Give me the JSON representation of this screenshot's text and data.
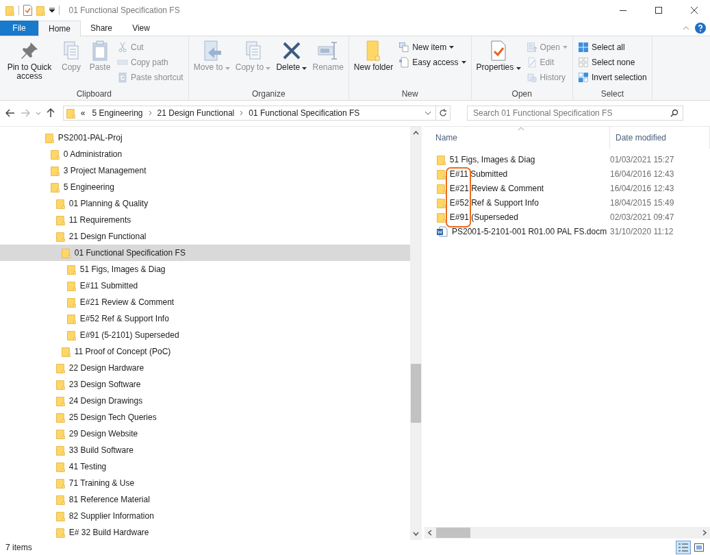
{
  "window": {
    "title": "01 Functional Specification FS"
  },
  "ribbon_tabs": [
    {
      "label": "File",
      "kind": "file",
      "selected": false
    },
    {
      "label": "Home",
      "kind": "tab",
      "selected": true
    },
    {
      "label": "Share",
      "kind": "tab",
      "selected": false
    },
    {
      "label": "View",
      "kind": "tab",
      "selected": false
    }
  ],
  "ribbon_groups": [
    {
      "label": "Clipboard",
      "large": [
        {
          "label": "Pin to Quick access",
          "disabled": false,
          "dropdown": false
        },
        {
          "label": "Copy",
          "disabled": true,
          "dropdown": false
        },
        {
          "label": "Paste",
          "disabled": true,
          "dropdown": false
        }
      ],
      "small": [
        {
          "label": "Cut",
          "disabled": true,
          "dropdown": false
        },
        {
          "label": "Copy path",
          "disabled": true,
          "dropdown": false
        },
        {
          "label": "Paste shortcut",
          "disabled": true,
          "dropdown": false
        }
      ]
    },
    {
      "label": "Organize",
      "large": [
        {
          "label": "Move to",
          "disabled": true,
          "dropdown": true
        },
        {
          "label": "Copy to",
          "disabled": true,
          "dropdown": true
        },
        {
          "label": "Delete",
          "disabled": false,
          "dropdown": true
        },
        {
          "label": "Rename",
          "disabled": true,
          "dropdown": false
        }
      ]
    },
    {
      "label": "New",
      "large": [
        {
          "label": "New folder",
          "disabled": false,
          "dropdown": false
        }
      ],
      "small": [
        {
          "label": "New item",
          "disabled": false,
          "dropdown": true
        },
        {
          "label": "Easy access",
          "disabled": false,
          "dropdown": true
        }
      ]
    },
    {
      "label": "Open",
      "large": [
        {
          "label": "Properties",
          "disabled": false,
          "dropdown": true
        }
      ],
      "small": [
        {
          "label": "Open",
          "disabled": true,
          "dropdown": true
        },
        {
          "label": "Edit",
          "disabled": true,
          "dropdown": false
        },
        {
          "label": "History",
          "disabled": true,
          "dropdown": false
        }
      ]
    },
    {
      "label": "Select",
      "small": [
        {
          "label": "Select all",
          "disabled": false,
          "dropdown": false
        },
        {
          "label": "Select none",
          "disabled": false,
          "dropdown": false
        },
        {
          "label": "Invert selection",
          "disabled": false,
          "dropdown": false
        }
      ]
    }
  ],
  "address": {
    "overflow": "«",
    "crumbs": [
      "5 Engineering",
      "21 Design Functional",
      "01 Functional Specification FS"
    ]
  },
  "search": {
    "placeholder": "Search 01 Functional Specification FS"
  },
  "tree": [
    {
      "label": "PS2001-PAL-Proj",
      "selected": false,
      "children": [
        {
          "label": "0 Administration",
          "selected": false
        },
        {
          "label": "3 Project Management",
          "selected": false
        },
        {
          "label": "5 Engineering",
          "selected": false,
          "children": [
            {
              "label": "01 Planning & Quality",
              "selected": false
            },
            {
              "label": "11 Requirements",
              "selected": false
            },
            {
              "label": "21 Design Functional",
              "selected": false,
              "children": [
                {
                  "label": "01 Functional Specification FS",
                  "selected": true,
                  "children": [
                    {
                      "label": "51 Figs, Images & Diag",
                      "selected": false
                    },
                    {
                      "label": "E#11 Submitted",
                      "selected": false
                    },
                    {
                      "label": "E#21 Review & Comment",
                      "selected": false
                    },
                    {
                      "label": "E#52 Ref & Support Info",
                      "selected": false
                    },
                    {
                      "label": "E#91 (5-2101) Superseded",
                      "selected": false
                    }
                  ]
                },
                {
                  "label": "11 Proof of Concept (PoC)",
                  "selected": false
                }
              ]
            },
            {
              "label": "22 Design Hardware",
              "selected": false
            },
            {
              "label": "23 Design Software",
              "selected": false
            },
            {
              "label": "24 Design Drawings",
              "selected": false
            },
            {
              "label": "25 Design Tech Queries",
              "selected": false
            },
            {
              "label": "29 Design Website",
              "selected": false
            },
            {
              "label": "33 Build Software",
              "selected": false
            },
            {
              "label": "41 Testing",
              "selected": false
            },
            {
              "label": "71 Training & Use",
              "selected": false
            },
            {
              "label": "81 Reference Material",
              "selected": false
            },
            {
              "label": "82 Supplier Information",
              "selected": false
            },
            {
              "label": "E# 32 Build Hardware",
              "selected": false
            }
          ]
        }
      ]
    }
  ],
  "columns": [
    "Name",
    "Date modified"
  ],
  "files": [
    {
      "name": "51 Figs, Images & Diag",
      "date": "01/03/2021 15:27",
      "kind": "folder"
    },
    {
      "name": "E#11 Submitted",
      "date": "16/04/2016 12:43",
      "kind": "folder"
    },
    {
      "name": "E#21 Review & Comment",
      "date": "16/04/2016 12:43",
      "kind": "folder"
    },
    {
      "name": "E#52 Ref & Support Info",
      "date": "18/04/2015 15:49",
      "kind": "folder"
    },
    {
      "name": "E#91 (Superseded",
      "date": "02/03/2021 09:47",
      "kind": "folder"
    },
    {
      "name": "PS2001-5-2101-001 R01.00 PAL FS.docm",
      "date": "31/10/2020 11:12",
      "kind": "document"
    }
  ],
  "status_bar": {
    "count": "7 items"
  }
}
